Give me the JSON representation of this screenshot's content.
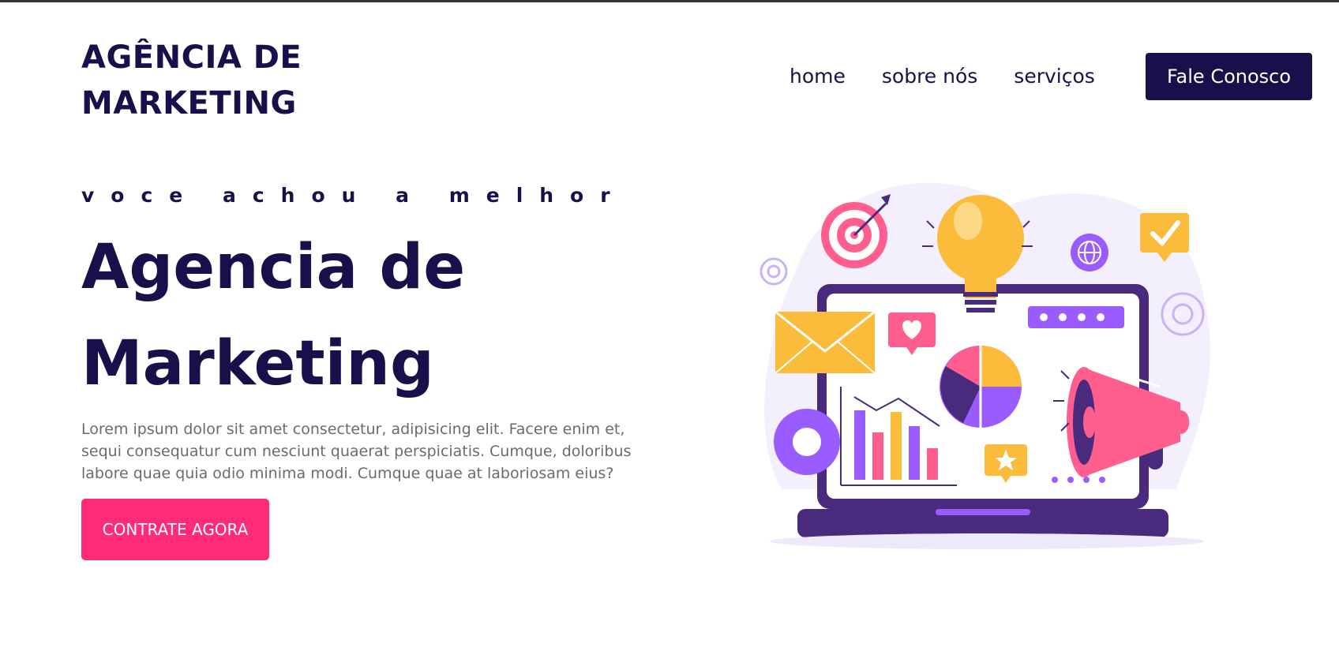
{
  "brand": {
    "line1": "AGÊNCIA DE",
    "line2": "MARKETING"
  },
  "nav": {
    "items": [
      "home",
      "sobre nós",
      "serviços"
    ]
  },
  "header": {
    "cta_label": "Fale Conosco"
  },
  "hero": {
    "eyebrow": "voce achou a melhor",
    "title_line1": "Agencia de",
    "title_line2": "Marketing",
    "description": "Lorem ipsum dolor sit amet consectetur, adipisicing elit. Facere enim et, sequi consequatur cum nesciunt quaerat perspiciatis. Cumque, doloribus labore quae quia odio minima modi. Cumque quae at laboriosam eius?",
    "cta_label": "CONTRATE AGORA"
  },
  "colors": {
    "navy": "#1a0f4a",
    "pink": "#ff2a78",
    "yellow": "#fbbc3c",
    "purple": "#9b5cff",
    "laptop": "#4a2a7d"
  }
}
